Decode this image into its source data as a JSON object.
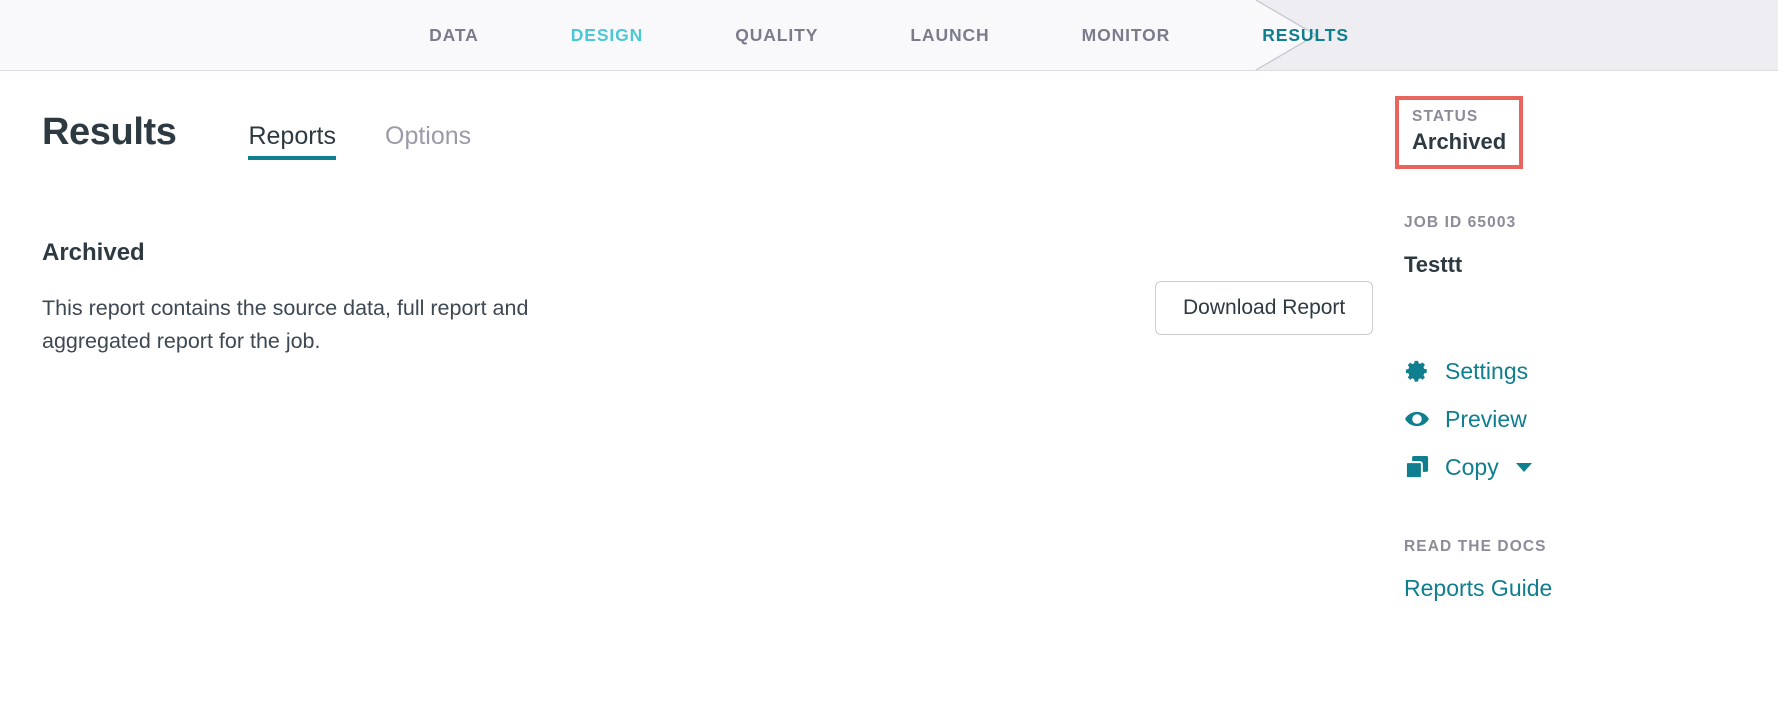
{
  "wizard": {
    "steps": [
      {
        "label": "DATA",
        "state": "inactive"
      },
      {
        "label": "DESIGN",
        "state": "visited"
      },
      {
        "label": "QUALITY",
        "state": "inactive"
      },
      {
        "label": "LAUNCH",
        "state": "inactive"
      },
      {
        "label": "MONITOR",
        "state": "inactive"
      },
      {
        "label": "RESULTS",
        "state": "current"
      }
    ]
  },
  "main": {
    "page_title": "Results",
    "tabs": [
      {
        "label": "Reports",
        "active": true
      },
      {
        "label": "Options",
        "active": false
      }
    ],
    "report": {
      "heading": "Archived",
      "description": "This report contains the source data, full report and aggregated report for the job.",
      "download_label": "Download Report"
    }
  },
  "sidebar": {
    "status_label": "STATUS",
    "status_value": "Archived",
    "job_id_label": "JOB ID 65003",
    "job_name": "Testtt",
    "actions": [
      {
        "label": "Settings",
        "icon": "gear-icon",
        "has_caret": false
      },
      {
        "label": "Preview",
        "icon": "eye-icon",
        "has_caret": false
      },
      {
        "label": "Copy",
        "icon": "copy-icon",
        "has_caret": true
      }
    ],
    "docs_heading": "READ THE DOCS",
    "docs_link": "Reports Guide"
  },
  "colors": {
    "teal_current": "#0f7e8e",
    "teal_visited": "#4cc8d4",
    "nav_inactive": "#7b7b8c",
    "annotation_red": "#e8645c",
    "header_bg": "#f9f9fb",
    "segment_bg": "#eeeef2",
    "text_dark": "#2e3a41"
  }
}
